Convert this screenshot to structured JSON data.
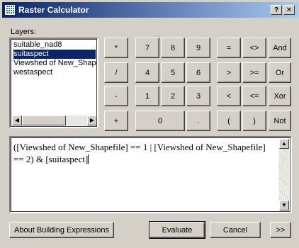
{
  "window": {
    "title": "Raster Calculator",
    "help_button": "?",
    "close_button": "✕"
  },
  "layers": {
    "label": "Layers:",
    "items": [
      {
        "label": "suitable_nad8"
      },
      {
        "label": "suitaspect",
        "selected": true
      },
      {
        "label": "Viewshed of New_Shapefile"
      },
      {
        "label": "westaspect"
      }
    ]
  },
  "calculator": {
    "operators": [
      "*",
      "/",
      "-",
      "+"
    ],
    "digits": [
      "7",
      "8",
      "9",
      "4",
      "5",
      "6",
      "1",
      "2",
      "3",
      "0",
      "."
    ],
    "comparison": [
      "=",
      "<>",
      ">",
      ">=",
      "<",
      "<="
    ],
    "parens": [
      "(",
      ")"
    ],
    "logical": [
      "And",
      "Or",
      "Xor",
      "Not"
    ]
  },
  "expression": {
    "line1": "([Viewshed of New_Shapefile] == 1 | [Viewshed of New_Shapefile]",
    "line2": "== 2) & [suitaspect]"
  },
  "footer": {
    "about_label": "About Building Expressions",
    "evaluate_label": "Evaluate",
    "cancel_label": "Cancel",
    "more_label": ">>"
  },
  "colors": {
    "titlebar_start": "#0a246a",
    "titlebar_end": "#a6caf0",
    "face": "#d4d0c8",
    "selection": "#0a246a"
  }
}
